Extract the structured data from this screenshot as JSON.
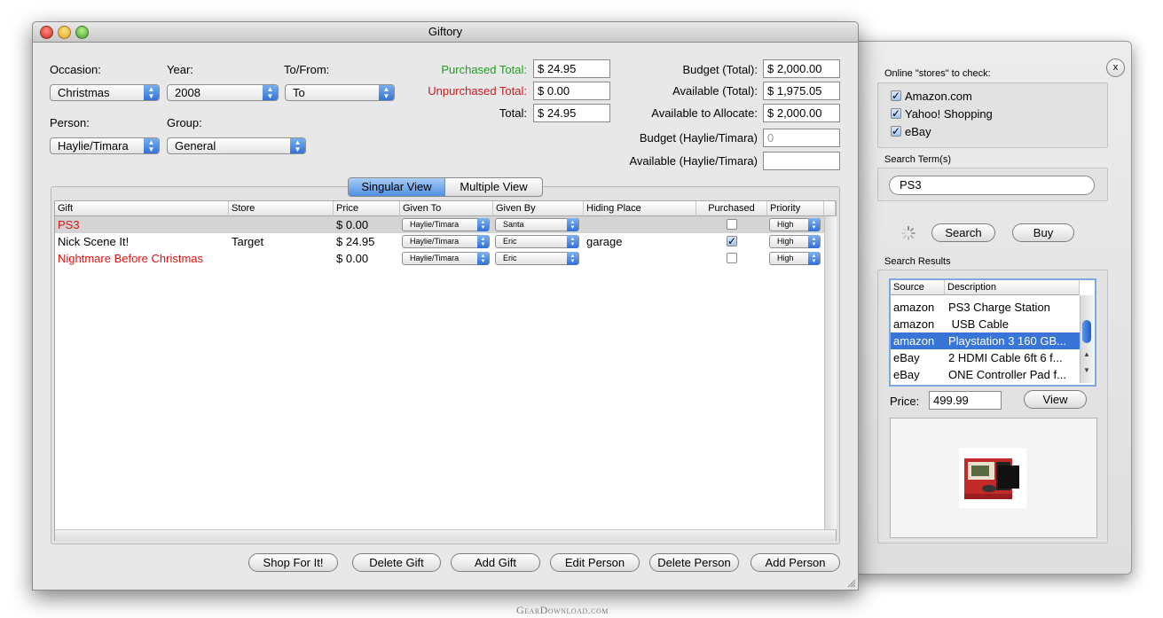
{
  "window": {
    "title": "Giftory"
  },
  "filters": {
    "occasion_label": "Occasion:",
    "occasion_value": "Christmas",
    "year_label": "Year:",
    "year_value": "2008",
    "tofrom_label": "To/From:",
    "tofrom_value": "To",
    "person_label": "Person:",
    "person_value": "Haylie/Timara",
    "group_label": "Group:",
    "group_value": "General"
  },
  "totals": {
    "purchased_label": "Purchased Total:",
    "purchased_value": "$ 24.95",
    "unpurchased_label": "Unpurchased Total:",
    "unpurchased_value": "$ 0.00",
    "total_label": "Total:",
    "total_value": "$ 24.95"
  },
  "budget": {
    "budget_total_label": "Budget (Total):",
    "budget_total_value": "$ 2,000.00",
    "available_total_label": "Available (Total):",
    "available_total_value": "$ 1,975.05",
    "available_allocate_label": "Available to Allocate:",
    "available_allocate_value": "$ 2,000.00",
    "budget_person_label": "Budget (Haylie/Timara)",
    "budget_person_value": "0",
    "available_person_label": "Available (Haylie/Timara)",
    "available_person_value": ""
  },
  "view_tabs": {
    "singular": "Singular View",
    "multiple": "Multiple View"
  },
  "table": {
    "columns": [
      "Gift",
      "Store",
      "Price",
      "Given To",
      "Given By",
      "Hiding Place",
      "Purchased",
      "Priority"
    ],
    "rows": [
      {
        "gift": "PS3",
        "store": "",
        "price": "$ 0.00",
        "given_to": "Haylie/Timara",
        "given_by": "Santa",
        "hiding": "",
        "purchased": false,
        "priority": "High"
      },
      {
        "gift": "Nick Scene It!",
        "store": "Target",
        "price": "$ 24.95",
        "given_to": "Haylie/Timara",
        "given_by": "Eric",
        "hiding": "garage",
        "purchased": true,
        "priority": "High"
      },
      {
        "gift": "Nightmare Before Christmas",
        "store": "",
        "price": "$ 0.00",
        "given_to": "Haylie/Timara",
        "given_by": "Eric",
        "hiding": "",
        "purchased": false,
        "priority": "High"
      }
    ]
  },
  "buttons": {
    "shop": "Shop For It!",
    "delete_gift": "Delete Gift",
    "add_gift": "Add Gift",
    "edit_person": "Edit Person",
    "delete_person": "Delete Person",
    "add_person": "Add Person"
  },
  "drawer": {
    "close_glyph": "x",
    "stores_label": "Online \"stores\" to check:",
    "stores": [
      {
        "name": "Amazon.com",
        "checked": true
      },
      {
        "name": "Yahoo! Shopping",
        "checked": true
      },
      {
        "name": "eBay",
        "checked": true
      }
    ],
    "search_term_label": "Search Term(s)",
    "search_term_value": "PS3",
    "search_button": "Search",
    "buy_button": "Buy",
    "results_label": "Search Results",
    "results_columns": [
      "Source",
      "Description"
    ],
    "results": [
      {
        "source": "amazon",
        "description": "PS3 Charge Station"
      },
      {
        "source": "amazon",
        "description": " USB Cable"
      },
      {
        "source": "amazon",
        "description": "Playstation 3 160 GB..."
      },
      {
        "source": "eBay",
        "description": "2 HDMI Cable 6ft 6 f..."
      },
      {
        "source": "eBay",
        "description": "ONE Controller Pad f..."
      }
    ],
    "price_label": "Price:",
    "price_value": "499.99",
    "view_button": "View"
  },
  "watermark": "GearDownload.com",
  "colors": {
    "purchased_green": "#1f9e1f",
    "unpurchased_red": "#cc1a1a",
    "gift_red": "#e01010",
    "selection_blue": "#3875d7"
  }
}
